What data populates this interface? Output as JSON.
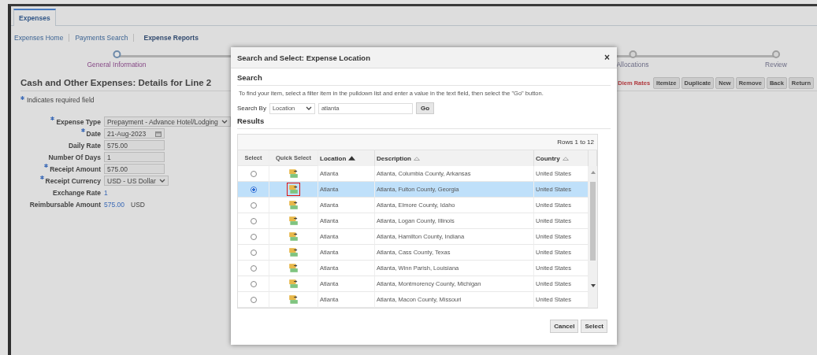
{
  "app_tab": {
    "label": "Expenses",
    "selected": true
  },
  "nav_links": [
    {
      "label": "Expenses Home",
      "selected": false
    },
    {
      "label": "Payments Search",
      "selected": false
    },
    {
      "label": "Expense Reports",
      "selected": true
    }
  ],
  "train_steps": [
    {
      "label": "General Information",
      "current": true
    },
    {
      "label": "Allocations",
      "current": false
    },
    {
      "label": "Review",
      "current": false
    }
  ],
  "page_title": "Cash and Other Expenses: Details for Line 2",
  "required_note": "Indicates required field",
  "actions": [
    {
      "label": "Diem Rates",
      "kind": "link"
    },
    {
      "label": "Itemize",
      "kind": "button"
    },
    {
      "label": "Duplicate",
      "kind": "button"
    },
    {
      "label": "New",
      "kind": "button"
    },
    {
      "label": "Remove",
      "kind": "button"
    },
    {
      "label": "Back",
      "kind": "button"
    },
    {
      "label": "Return",
      "kind": "button"
    }
  ],
  "fields": [
    {
      "label": "Expense Type",
      "required": true,
      "kind": "select",
      "value": "Prepayment - Advance Hotel/Lodging"
    },
    {
      "label": "Date",
      "required": true,
      "kind": "date",
      "value": "21-Aug-2023"
    },
    {
      "label": "Daily Rate",
      "required": false,
      "kind": "input",
      "value": "575.00"
    },
    {
      "label": "Number Of Days",
      "required": false,
      "kind": "input",
      "value": "1"
    },
    {
      "label": "Receipt Amount",
      "required": true,
      "kind": "input",
      "value": "575.00"
    },
    {
      "label": "Receipt Currency",
      "required": true,
      "kind": "select",
      "value": "USD - US Dollar"
    },
    {
      "label": "Exchange Rate",
      "required": false,
      "kind": "text",
      "value": "1"
    },
    {
      "label": "Reimbursable Amount",
      "required": false,
      "kind": "text",
      "value": "575.00",
      "unit": "USD"
    }
  ],
  "dialog": {
    "title": "Search and Select: Expense Location",
    "close": "×",
    "search_heading": "Search",
    "instructions": "To find your item, select a filter item in the pulldown list and enter a value in the text field, then select the \"Go\" button.",
    "search_by_label": "Search By",
    "filter": "Location",
    "search_value": "atlanta",
    "go": "Go",
    "results_heading": "Results",
    "rows_range": "Rows 1 to 12",
    "columns": [
      {
        "label": "Select",
        "sortable": false
      },
      {
        "label": "Quick Select",
        "sortable": false
      },
      {
        "label": "Location",
        "sortable": true,
        "sorted": true
      },
      {
        "label": "Description",
        "sortable": true,
        "sorted": false
      },
      {
        "label": "Country",
        "sortable": true,
        "sorted": false
      }
    ],
    "rows": [
      {
        "selected": false,
        "location": "Atlanta",
        "description": "Atlanta, Columbia County, Arkansas",
        "country": "United States"
      },
      {
        "selected": true,
        "location": "Atlanta",
        "description": "Atlanta, Fulton County, Georgia",
        "country": "United States"
      },
      {
        "selected": false,
        "location": "Atlanta",
        "description": "Atlanta, Elmore County, Idaho",
        "country": "United States"
      },
      {
        "selected": false,
        "location": "Atlanta",
        "description": "Atlanta, Logan County, Illinois",
        "country": "United States"
      },
      {
        "selected": false,
        "location": "Atlanta",
        "description": "Atlanta, Hamilton County, Indiana",
        "country": "United States"
      },
      {
        "selected": false,
        "location": "Atlanta",
        "description": "Atlanta, Cass County, Texas",
        "country": "United States"
      },
      {
        "selected": false,
        "location": "Atlanta",
        "description": "Atlanta, Winn Parish, Louisiana",
        "country": "United States"
      },
      {
        "selected": false,
        "location": "Atlanta",
        "description": "Atlanta, Montmorency County, Michigan",
        "country": "United States"
      },
      {
        "selected": false,
        "location": "Atlanta",
        "description": "Atlanta, Macon County, Missouri",
        "country": "United States"
      }
    ],
    "buttons": [
      "Cancel",
      "Select"
    ]
  }
}
